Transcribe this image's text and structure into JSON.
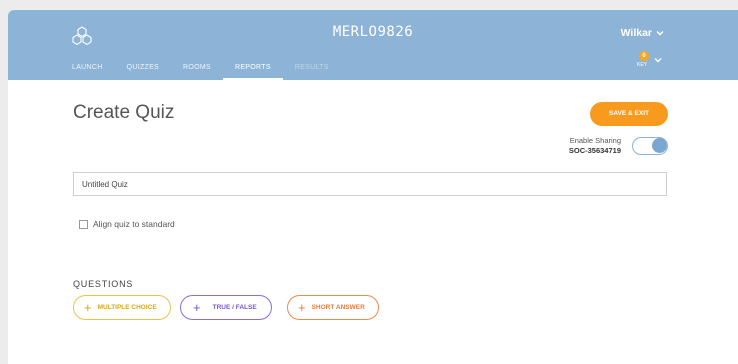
{
  "header": {
    "room_code": "MERLO9826",
    "username": "Wilkar",
    "notification_count": "0",
    "notification_label": "KEY",
    "nav": [
      {
        "label": "LAUNCH",
        "state": "normal"
      },
      {
        "label": "QUIZZES",
        "state": "normal"
      },
      {
        "label": "ROOMS",
        "state": "normal"
      },
      {
        "label": "REPORTS",
        "state": "active"
      },
      {
        "label": "RESULTS",
        "state": "disabled"
      }
    ],
    "colors": {
      "bar": "#8db4d6",
      "badge": "#f5a623"
    }
  },
  "main": {
    "title": "Create Quiz",
    "save_label": "SAVE & EXIT",
    "sharing_label": "Enable Sharing",
    "sharing_code": "SOC-35634719",
    "sharing_enabled": true,
    "quiz_name_value": "Untitled Quiz",
    "align_label": "Align quiz to standard",
    "align_checked": false,
    "colors": {
      "save": "#f79a1e"
    }
  },
  "questions": {
    "heading": "QUESTIONS",
    "buttons": [
      {
        "label": "MULTIPLE CHOICE",
        "color": "#e8c24a"
      },
      {
        "label": "TRUE / FALSE",
        "color": "#8c6fd6"
      },
      {
        "label": "SHORT ANSWER",
        "color": "#f0894e"
      }
    ]
  }
}
